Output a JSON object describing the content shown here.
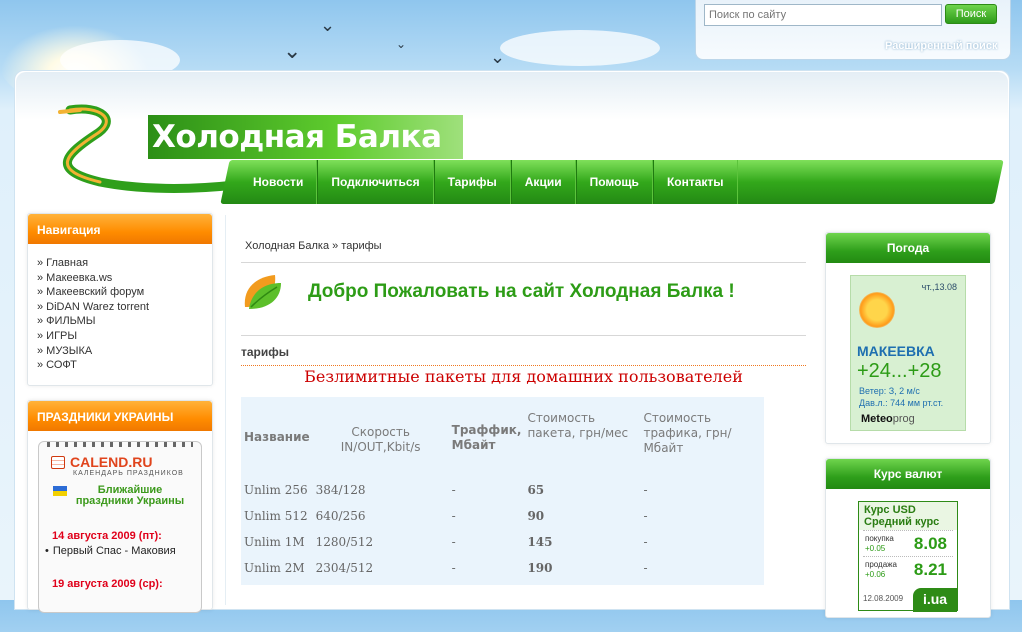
{
  "search": {
    "placeholder": "Поиск по сайту",
    "button_label": "Поиск",
    "advanced_label": "Расширенный поиск"
  },
  "site": {
    "title": "Холодная Балка"
  },
  "nav": {
    "items": [
      "Новости",
      "Подключиться",
      "Тарифы",
      "Акции",
      "Помощь",
      "Контакты"
    ]
  },
  "sidebar_left": {
    "navigation": {
      "title": "Навигация",
      "items": [
        "» Главная",
        "» Макеевка.ws",
        "» Макеевский форум",
        "» DiDAN Warez torrent",
        "» ФИЛЬМЫ",
        "» ИГРЫ",
        "» МУЗЫКА",
        "» СОФТ"
      ]
    },
    "holidays": {
      "title": "ПРАЗДНИКИ УКРАИНЫ",
      "calendar_logo": "CALEND.RU",
      "calendar_sub": "КАЛЕНДАРЬ ПРАЗДНИКОВ",
      "upcoming": "Ближайшие праздники Украины",
      "date1": "14 августа 2009 (пт):",
      "event1": "Первый Спас - Маковия",
      "date2": "19 августа 2009 (ср):"
    }
  },
  "content": {
    "breadcrumb": "Холодная Балка » тарифы",
    "welcome": "Добро Пожаловать на сайт Холодная Балка !",
    "section_title": "тарифы",
    "packages_title": "Безлимитные пакеты для домашних пользователей",
    "table": {
      "headers": [
        "Название",
        "Скорость IN/OUT,Kbit/s",
        "Траффик, Мбайт",
        "Стоимость пакета, грн/мес",
        "Стоимость трафика, грн/Мбайт"
      ],
      "rows": [
        [
          "Unlim 256",
          "384/128",
          "-",
          "65",
          "-"
        ],
        [
          "Unlim 512",
          "640/256",
          "-",
          "90",
          "-"
        ],
        [
          "Unlim 1M",
          "1280/512",
          "-",
          "145",
          "-"
        ],
        [
          "Unlim 2M",
          "2304/512",
          "-",
          "190",
          "-"
        ]
      ]
    }
  },
  "sidebar_right": {
    "weather": {
      "title": "Погода",
      "date": "чт.,13.08",
      "city": "МАКЕЕВКА",
      "temp": "+24...+28",
      "wind": "Ветер: З, 2 м/с",
      "pressure": "Дав.л.: 744 мм рт.ст.",
      "brand_a": "Meteo",
      "brand_b": "prog"
    },
    "currency": {
      "title": "Курс валют",
      "card_title_1": "Курс USD",
      "card_title_2": "Средний курс",
      "buy_label": "покупка",
      "buy_delta": "+0.05",
      "buy_value": "8.08",
      "sell_label": "продажа",
      "sell_delta": "+0.06",
      "sell_value": "8.21",
      "date": "12.08.2009",
      "brand": "i.ua"
    }
  },
  "colors": {
    "accent_green": "#2d9c16",
    "accent_orange": "#ff8c00",
    "accent_red": "#cc0000"
  }
}
